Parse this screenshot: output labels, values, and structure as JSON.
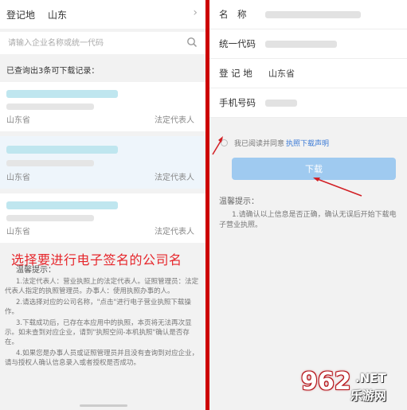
{
  "left": {
    "region_label": "登记地",
    "region_value": "山东",
    "search_placeholder": "请输入企业名称或统一代码",
    "result_count": "已查询出3条可下载记录：",
    "results": [
      {
        "province": "山东省",
        "rep": "法定代表人"
      },
      {
        "province": "山东省",
        "rep": "法定代表人"
      },
      {
        "province": "山东省",
        "rep": "法定代表人"
      }
    ],
    "annotation": "选择要进行电子签名的公司名",
    "tips_title": "温馨提示：",
    "tips": [
      "1.法定代表人：营业执照上的法定代表人。证照管理员：法定代表人指定的执照管理员。办事人：使用执照办事的人。",
      "2.请选择对应的公司名称，\"点击\"进行电子营业执照下载操作。",
      "3.下载成功后，已存在本应用中的执照，本页将无法再次显示。如未查到对应企业，请到\"执照空间-本机执照\"确认是否存在。",
      "4.如果您是办事人员或证照管理员并且没有查询到对应企业，请与授权人确认信息录入或者授权是否成功。"
    ]
  },
  "right": {
    "fields": [
      {
        "label": "名　称",
        "value": ""
      },
      {
        "label": "统一代码",
        "value": ""
      },
      {
        "label": "登 记 地",
        "value": "山东省"
      },
      {
        "label": "手机号码",
        "value": ""
      }
    ],
    "agree_text": "我已阅读并同意",
    "agree_link": "执照下载声明",
    "download_label": "下载",
    "tips_title": "温馨提示：",
    "tips_text": "1.请确认以上信息是否正确，确认无误后开始下载电子营业执照。"
  },
  "watermark": {
    "num": "962",
    "net": ".NET",
    "cn": "乐游网"
  },
  "colors": {
    "accent": "#e6262b",
    "button": "#9fcaf0",
    "link": "#3c7bd6",
    "divider": "#cc0000"
  }
}
